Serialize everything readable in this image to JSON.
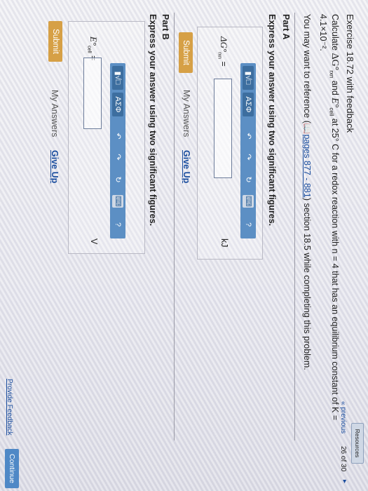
{
  "header": {
    "resources_label": "Resources",
    "previous_label": "« previous",
    "page_counter": "26 of 30"
  },
  "exercise": {
    "title": "Exercise 18.72 with feedback",
    "line1_a": "Calculate ",
    "delta_g": "ΔG°",
    "rxn_sub": "rxn",
    "and_text": " and ",
    "e_cell": "E°",
    "cell_sub": "cell",
    "line1_b": " at 25° C for a redox reaction with n = 4 that has an equilibrium constant of K =",
    "line2": "4.1×10⁻².",
    "reference_a": "You may want to reference (",
    "reference_link": "pages 877 - 881",
    "reference_b": ") section 18.5 while completing this problem."
  },
  "part_a": {
    "label": "Part A",
    "instruction": "Express your answer using two significant figures.",
    "var_label": "ΔG°",
    "var_sub": "rxn",
    "equals": "=",
    "unit": "kJ",
    "submit_label": "Submit",
    "my_answers": "My Answers",
    "give_up": "Give Up"
  },
  "part_b": {
    "label": "Part B",
    "instruction": "Express your answer using two significant figures.",
    "var_label": "E°",
    "var_sub": "cell",
    "equals": "=",
    "unit": "V",
    "submit_label": "Submit",
    "my_answers": "My Answers",
    "give_up": "Give Up"
  },
  "toolbar": {
    "template_icon": "▮√□",
    "greek_label": "ΑΣΦ",
    "undo_icon": "↶",
    "redo_icon": "↷",
    "reset_icon": "↻",
    "keyboard_icon": "⌨",
    "help_icon": "?"
  },
  "footer": {
    "feedback_link": "Provide Feedback",
    "continue_label": "Continue"
  }
}
